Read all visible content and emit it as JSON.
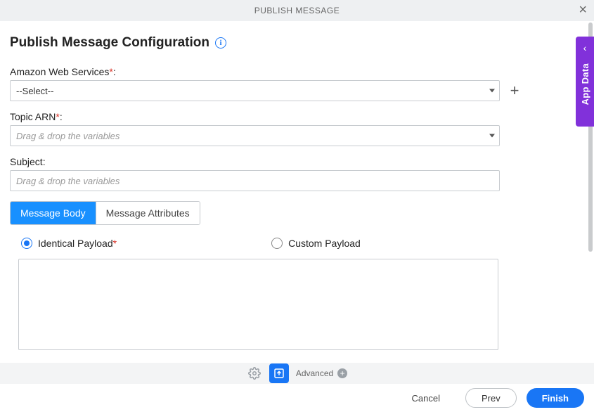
{
  "titlebar": {
    "title": "PUBLISH MESSAGE"
  },
  "heading": "Publish Message Configuration",
  "fields": {
    "aws": {
      "label": "Amazon Web Services",
      "required": "*",
      "value": "--Select--"
    },
    "topic": {
      "label": "Topic ARN",
      "required": "*",
      "placeholder": "Drag & drop the variables"
    },
    "subject": {
      "label": "Subject:",
      "placeholder": "Drag & drop the variables"
    }
  },
  "tabs": {
    "body": "Message Body",
    "attrs": "Message Attributes"
  },
  "radios": {
    "identical": "Identical Payload",
    "identical_req": "*",
    "custom": "Custom Payload"
  },
  "toolbar": {
    "advanced": "Advanced"
  },
  "footer": {
    "cancel": "Cancel",
    "prev": "Prev",
    "finish": "Finish"
  },
  "side": {
    "label": "App Data"
  }
}
